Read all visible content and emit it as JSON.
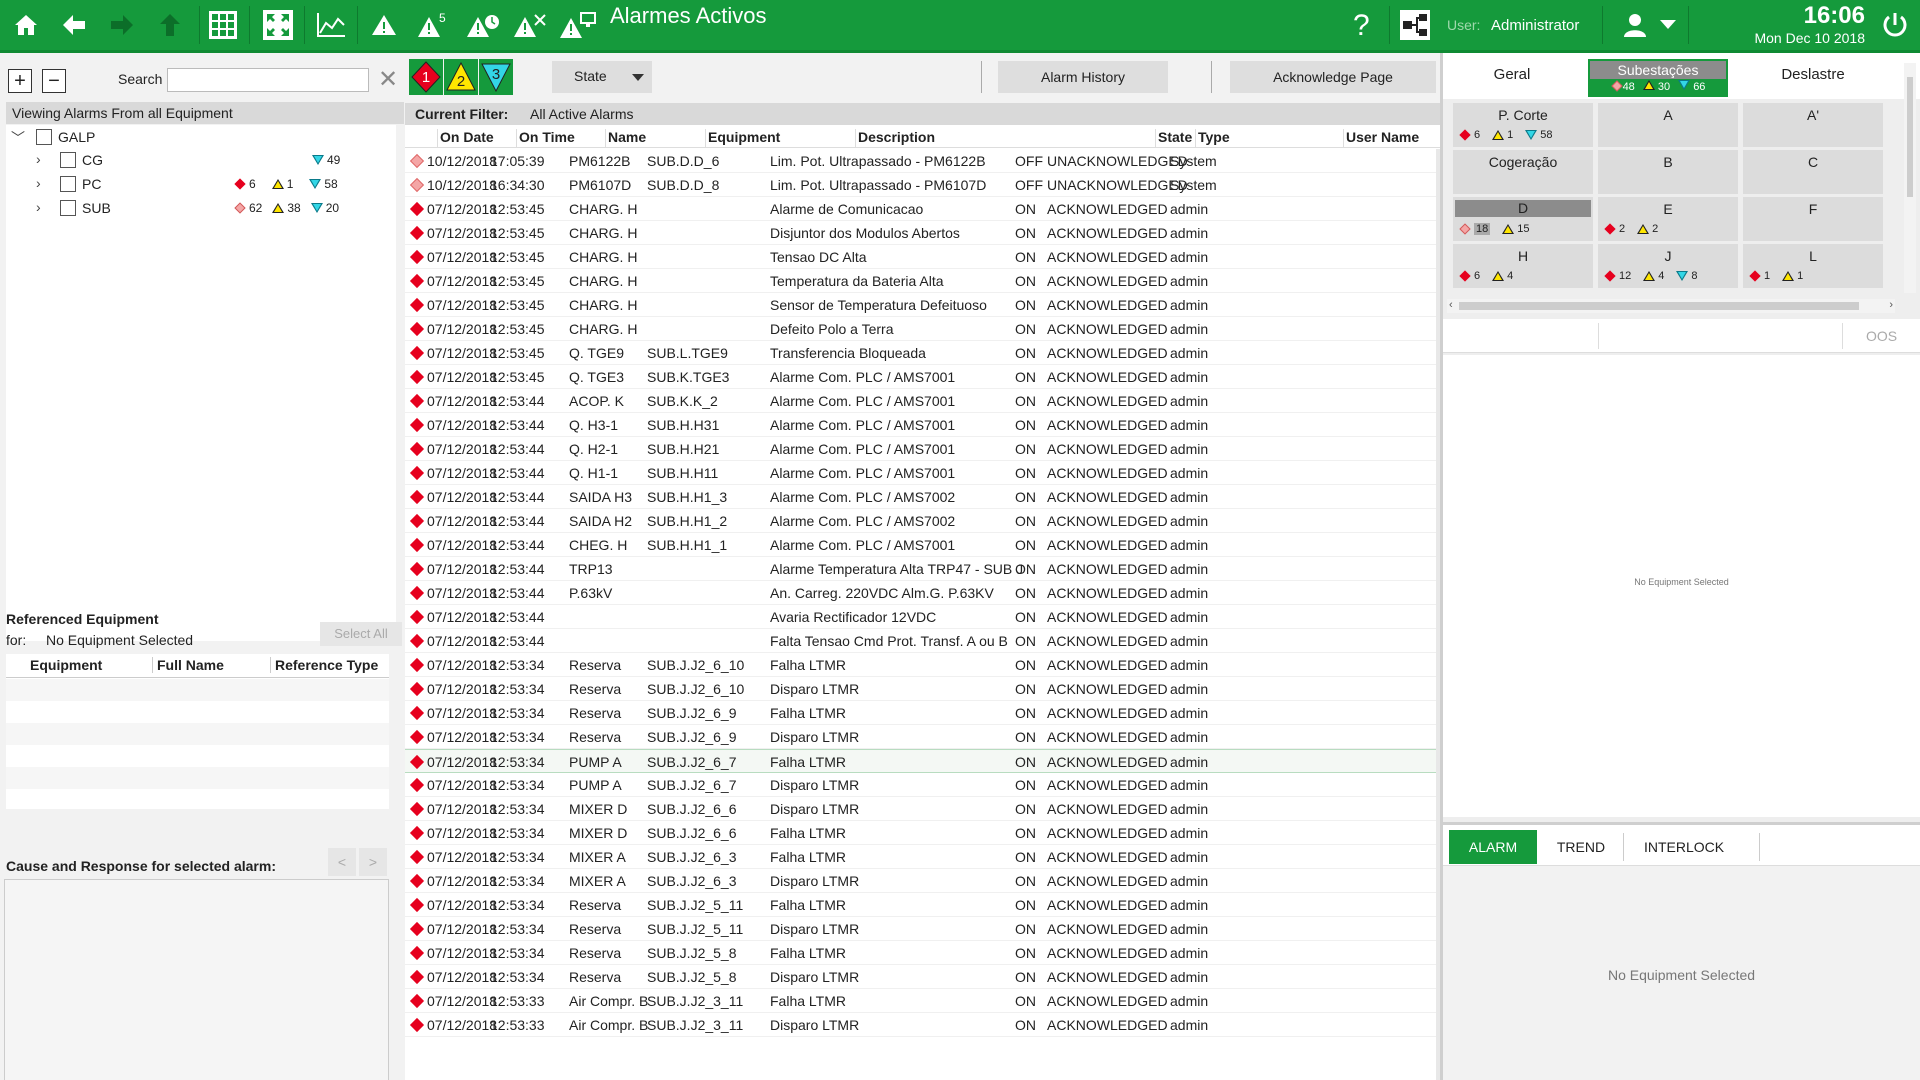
{
  "header": {
    "title": "Alarmes Activos",
    "user_label": "User:",
    "user_name": "Administrator",
    "time": "16:06",
    "date": "Mon Dec 10 2018",
    "icons": [
      "home-icon",
      "back-arrow-icon",
      "forward-arrow-icon",
      "up-arrow-icon",
      "grid-icon",
      "fullscreen-icon",
      "trend-chart-icon",
      "alarm-icon",
      "alarm-priority-icon",
      "alarm-timer-icon",
      "alarm-clear-icon",
      "alarm-screen-icon",
      "help-icon",
      "network-icon",
      "user-icon",
      "power-icon"
    ],
    "alarm_priority_badge": "5"
  },
  "left": {
    "search_label": "Search",
    "search_value": "",
    "viewing_label": "Viewing Alarms From all Equipment",
    "tree": [
      {
        "label": "GALP",
        "expanded": true
      },
      {
        "label": "CG",
        "red": "",
        "yellow": "",
        "cyan": "49"
      },
      {
        "label": "PC",
        "red": "6",
        "yellow": "1",
        "cyan": "58"
      },
      {
        "label": "SUB",
        "pink": "62",
        "yellow": "38",
        "cyan": "20"
      }
    ],
    "ref_title": "Referenced Equipment",
    "ref_for": "for:",
    "ref_none": "No Equipment Selected",
    "select_all": "Select All",
    "ref_columns": [
      "Equipment",
      "Full Name",
      "Reference Type"
    ],
    "cause_title": "Cause and Response for selected alarm:",
    "nav_prev": "<",
    "nav_next": ">"
  },
  "toolbar": {
    "priorities": [
      {
        "label": "1",
        "color": "#e6001e"
      },
      {
        "label": "2",
        "color": "#ffe600"
      },
      {
        "label": "3",
        "color": "#33d6e6"
      }
    ],
    "state_label": "State",
    "alarm_history": "Alarm History",
    "acknowledge_page": "Acknowledge Page",
    "filter_label": "Current Filter:",
    "filter_value": "All Active Alarms"
  },
  "columns": [
    "On Date",
    "On Time",
    "Name",
    "Equipment",
    "Description",
    "State",
    "Type",
    "User Name"
  ],
  "alarms": [
    {
      "kind": "pink",
      "date": "10/12/2018",
      "time": "17:05:39",
      "name": "PM6122B",
      "equip": "SUB.D.D_6",
      "desc": "Lim. Pot. Ultrapassado - PM6122B",
      "state": "OFF",
      "type": "UNACKNOWLEDGED",
      "user": "System"
    },
    {
      "kind": "pink",
      "date": "10/12/2018",
      "time": "16:34:30",
      "name": "PM6107D",
      "equip": "SUB.D.D_8",
      "desc": "Lim. Pot. Ultrapassado - PM6107D",
      "state": "OFF",
      "type": "UNACKNOWLEDGED",
      "user": "System"
    },
    {
      "kind": "red",
      "date": "07/12/2018",
      "time": "12:53:45",
      "name": "CHARG. H",
      "equip": "",
      "desc": "Alarme de Comunicacao",
      "state": "ON",
      "type": "ACKNOWLEDGED",
      "user": "admin"
    },
    {
      "kind": "red",
      "date": "07/12/2018",
      "time": "12:53:45",
      "name": "CHARG. H",
      "equip": "",
      "desc": "Disjuntor dos Modulos Abertos",
      "state": "ON",
      "type": "ACKNOWLEDGED",
      "user": "admin"
    },
    {
      "kind": "red",
      "date": "07/12/2018",
      "time": "12:53:45",
      "name": "CHARG. H",
      "equip": "",
      "desc": "Tensao DC Alta",
      "state": "ON",
      "type": "ACKNOWLEDGED",
      "user": "admin"
    },
    {
      "kind": "red",
      "date": "07/12/2018",
      "time": "12:53:45",
      "name": "CHARG. H",
      "equip": "",
      "desc": "Temperatura da Bateria Alta",
      "state": "ON",
      "type": "ACKNOWLEDGED",
      "user": "admin"
    },
    {
      "kind": "red",
      "date": "07/12/2018",
      "time": "12:53:45",
      "name": "CHARG. H",
      "equip": "",
      "desc": "Sensor de Temperatura Defeituoso",
      "state": "ON",
      "type": "ACKNOWLEDGED",
      "user": "admin"
    },
    {
      "kind": "red",
      "date": "07/12/2018",
      "time": "12:53:45",
      "name": "CHARG. H",
      "equip": "",
      "desc": "Defeito Polo a Terra",
      "state": "ON",
      "type": "ACKNOWLEDGED",
      "user": "admin"
    },
    {
      "kind": "red",
      "date": "07/12/2018",
      "time": "12:53:45",
      "name": "Q. TGE9",
      "equip": "SUB.L.TGE9",
      "desc": "Transferencia Bloqueada",
      "state": "ON",
      "type": "ACKNOWLEDGED",
      "user": "admin"
    },
    {
      "kind": "red",
      "date": "07/12/2018",
      "time": "12:53:45",
      "name": "Q. TGE3",
      "equip": "SUB.K.TGE3",
      "desc": "Alarme Com. PLC / AMS7001",
      "state": "ON",
      "type": "ACKNOWLEDGED",
      "user": "admin"
    },
    {
      "kind": "red",
      "date": "07/12/2018",
      "time": "12:53:44",
      "name": "ACOP. K",
      "equip": "SUB.K.K_2",
      "desc": "Alarme Com. PLC / AMS7001",
      "state": "ON",
      "type": "ACKNOWLEDGED",
      "user": "admin"
    },
    {
      "kind": "red",
      "date": "07/12/2018",
      "time": "12:53:44",
      "name": "Q. H3-1",
      "equip": "SUB.H.H31",
      "desc": "Alarme Com. PLC / AMS7001",
      "state": "ON",
      "type": "ACKNOWLEDGED",
      "user": "admin"
    },
    {
      "kind": "red",
      "date": "07/12/2018",
      "time": "12:53:44",
      "name": "Q. H2-1",
      "equip": "SUB.H.H21",
      "desc": "Alarme Com. PLC / AMS7001",
      "state": "ON",
      "type": "ACKNOWLEDGED",
      "user": "admin"
    },
    {
      "kind": "red",
      "date": "07/12/2018",
      "time": "12:53:44",
      "name": "Q. H1-1",
      "equip": "SUB.H.H11",
      "desc": "Alarme Com. PLC / AMS7001",
      "state": "ON",
      "type": "ACKNOWLEDGED",
      "user": "admin"
    },
    {
      "kind": "red",
      "date": "07/12/2018",
      "time": "12:53:44",
      "name": "SAIDA H3",
      "equip": "SUB.H.H1_3",
      "desc": "Alarme Com. PLC / AMS7002",
      "state": "ON",
      "type": "ACKNOWLEDGED",
      "user": "admin"
    },
    {
      "kind": "red",
      "date": "07/12/2018",
      "time": "12:53:44",
      "name": "SAIDA H2",
      "equip": "SUB.H.H1_2",
      "desc": "Alarme Com. PLC / AMS7002",
      "state": "ON",
      "type": "ACKNOWLEDGED",
      "user": "admin"
    },
    {
      "kind": "red",
      "date": "07/12/2018",
      "time": "12:53:44",
      "name": "CHEG. H",
      "equip": "SUB.H.H1_1",
      "desc": "Alarme Com. PLC / AMS7001",
      "state": "ON",
      "type": "ACKNOWLEDGED",
      "user": "admin"
    },
    {
      "kind": "red",
      "date": "07/12/2018",
      "time": "12:53:44",
      "name": "TRP13",
      "equip": "",
      "desc": "Alarme Temperatura Alta TRP47 - SUB J",
      "state": "ON",
      "type": "ACKNOWLEDGED",
      "user": "admin"
    },
    {
      "kind": "red",
      "date": "07/12/2018",
      "time": "12:53:44",
      "name": "P.63kV",
      "equip": "",
      "desc": "An. Carreg. 220VDC Alm.G. P.63KV",
      "state": "ON",
      "type": "ACKNOWLEDGED",
      "user": "admin"
    },
    {
      "kind": "red",
      "date": "07/12/2018",
      "time": "12:53:44",
      "name": "",
      "equip": "",
      "desc": "Avaria Rectificador 12VDC",
      "state": "ON",
      "type": "ACKNOWLEDGED",
      "user": "admin"
    },
    {
      "kind": "red",
      "date": "07/12/2018",
      "time": "12:53:44",
      "name": "",
      "equip": "",
      "desc": "Falta Tensao Cmd Prot. Transf. A ou B",
      "state": "ON",
      "type": "ACKNOWLEDGED",
      "user": "admin"
    },
    {
      "kind": "red",
      "date": "07/12/2018",
      "time": "12:53:34",
      "name": "Reserva",
      "equip": "SUB.J.J2_6_10",
      "desc": "Falha LTMR",
      "state": "ON",
      "type": "ACKNOWLEDGED",
      "user": "admin"
    },
    {
      "kind": "red",
      "date": "07/12/2018",
      "time": "12:53:34",
      "name": "Reserva",
      "equip": "SUB.J.J2_6_10",
      "desc": "Disparo LTMR",
      "state": "ON",
      "type": "ACKNOWLEDGED",
      "user": "admin"
    },
    {
      "kind": "red",
      "date": "07/12/2018",
      "time": "12:53:34",
      "name": "Reserva",
      "equip": "SUB.J.J2_6_9",
      "desc": "Falha LTMR",
      "state": "ON",
      "type": "ACKNOWLEDGED",
      "user": "admin"
    },
    {
      "kind": "red",
      "date": "07/12/2018",
      "time": "12:53:34",
      "name": "Reserva",
      "equip": "SUB.J.J2_6_9",
      "desc": "Disparo LTMR",
      "state": "ON",
      "type": "ACKNOWLEDGED",
      "user": "admin"
    },
    {
      "kind": "red",
      "date": "07/12/2018",
      "time": "12:53:34",
      "name": "PUMP A",
      "equip": "SUB.J.J2_6_7",
      "desc": "Falha LTMR",
      "state": "ON",
      "type": "ACKNOWLEDGED",
      "user": "admin",
      "selected": true
    },
    {
      "kind": "red",
      "date": "07/12/2018",
      "time": "12:53:34",
      "name": "PUMP A",
      "equip": "SUB.J.J2_6_7",
      "desc": "Disparo LTMR",
      "state": "ON",
      "type": "ACKNOWLEDGED",
      "user": "admin"
    },
    {
      "kind": "red",
      "date": "07/12/2018",
      "time": "12:53:34",
      "name": "MIXER D",
      "equip": "SUB.J.J2_6_6",
      "desc": "Disparo LTMR",
      "state": "ON",
      "type": "ACKNOWLEDGED",
      "user": "admin"
    },
    {
      "kind": "red",
      "date": "07/12/2018",
      "time": "12:53:34",
      "name": "MIXER D",
      "equip": "SUB.J.J2_6_6",
      "desc": "Falha LTMR",
      "state": "ON",
      "type": "ACKNOWLEDGED",
      "user": "admin"
    },
    {
      "kind": "red",
      "date": "07/12/2018",
      "time": "12:53:34",
      "name": "MIXER A",
      "equip": "SUB.J.J2_6_3",
      "desc": "Falha LTMR",
      "state": "ON",
      "type": "ACKNOWLEDGED",
      "user": "admin"
    },
    {
      "kind": "red",
      "date": "07/12/2018",
      "time": "12:53:34",
      "name": "MIXER A",
      "equip": "SUB.J.J2_6_3",
      "desc": "Disparo LTMR",
      "state": "ON",
      "type": "ACKNOWLEDGED",
      "user": "admin"
    },
    {
      "kind": "red",
      "date": "07/12/2018",
      "time": "12:53:34",
      "name": "Reserva",
      "equip": "SUB.J.J2_5_11",
      "desc": "Falha LTMR",
      "state": "ON",
      "type": "ACKNOWLEDGED",
      "user": "admin"
    },
    {
      "kind": "red",
      "date": "07/12/2018",
      "time": "12:53:34",
      "name": "Reserva",
      "equip": "SUB.J.J2_5_11",
      "desc": "Disparo LTMR",
      "state": "ON",
      "type": "ACKNOWLEDGED",
      "user": "admin"
    },
    {
      "kind": "red",
      "date": "07/12/2018",
      "time": "12:53:34",
      "name": "Reserva",
      "equip": "SUB.J.J2_5_8",
      "desc": "Falha LTMR",
      "state": "ON",
      "type": "ACKNOWLEDGED",
      "user": "admin"
    },
    {
      "kind": "red",
      "date": "07/12/2018",
      "time": "12:53:34",
      "name": "Reserva",
      "equip": "SUB.J.J2_5_8",
      "desc": "Disparo LTMR",
      "state": "ON",
      "type": "ACKNOWLEDGED",
      "user": "admin"
    },
    {
      "kind": "red",
      "date": "07/12/2018",
      "time": "12:53:33",
      "name": "Air Compr. B",
      "equip": "SUB.J.J2_3_11",
      "desc": "Falha LTMR",
      "state": "ON",
      "type": "ACKNOWLEDGED",
      "user": "admin"
    },
    {
      "kind": "red",
      "date": "07/12/2018",
      "time": "12:53:33",
      "name": "Air Compr. B",
      "equip": "SUB.J.J2_3_11",
      "desc": "Disparo LTMR",
      "state": "ON",
      "type": "ACKNOWLEDGED",
      "user": "admin"
    }
  ],
  "right": {
    "tabs": [
      "Geral",
      "Subestações",
      "Deslastre"
    ],
    "active_tab_counts": {
      "pink": "48",
      "yellow": "30",
      "cyan": "66"
    },
    "cells": [
      {
        "name": "P. Corte",
        "red": "6",
        "yellow": "1",
        "cyan": "58"
      },
      {
        "name": "A"
      },
      {
        "name": "A'"
      },
      {
        "name": "Cogeração"
      },
      {
        "name": "B"
      },
      {
        "name": "C"
      },
      {
        "name": "D",
        "pink": "18",
        "yellow": "15"
      },
      {
        "name": "E",
        "red": "2",
        "yellow": "2"
      },
      {
        "name": "F"
      },
      {
        "name": "H",
        "red": "6",
        "yellow": "4"
      },
      {
        "name": "J",
        "red": "12",
        "yellow": "4",
        "cyan": "8"
      },
      {
        "name": "L",
        "red": "1",
        "yellow": "1"
      }
    ],
    "oos": "OOS",
    "no_eq_small": "No Equipment Selected",
    "bottom_tabs": [
      "ALARM",
      "TREND",
      "INTERLOCK"
    ],
    "no_eq": "No Equipment Selected"
  }
}
